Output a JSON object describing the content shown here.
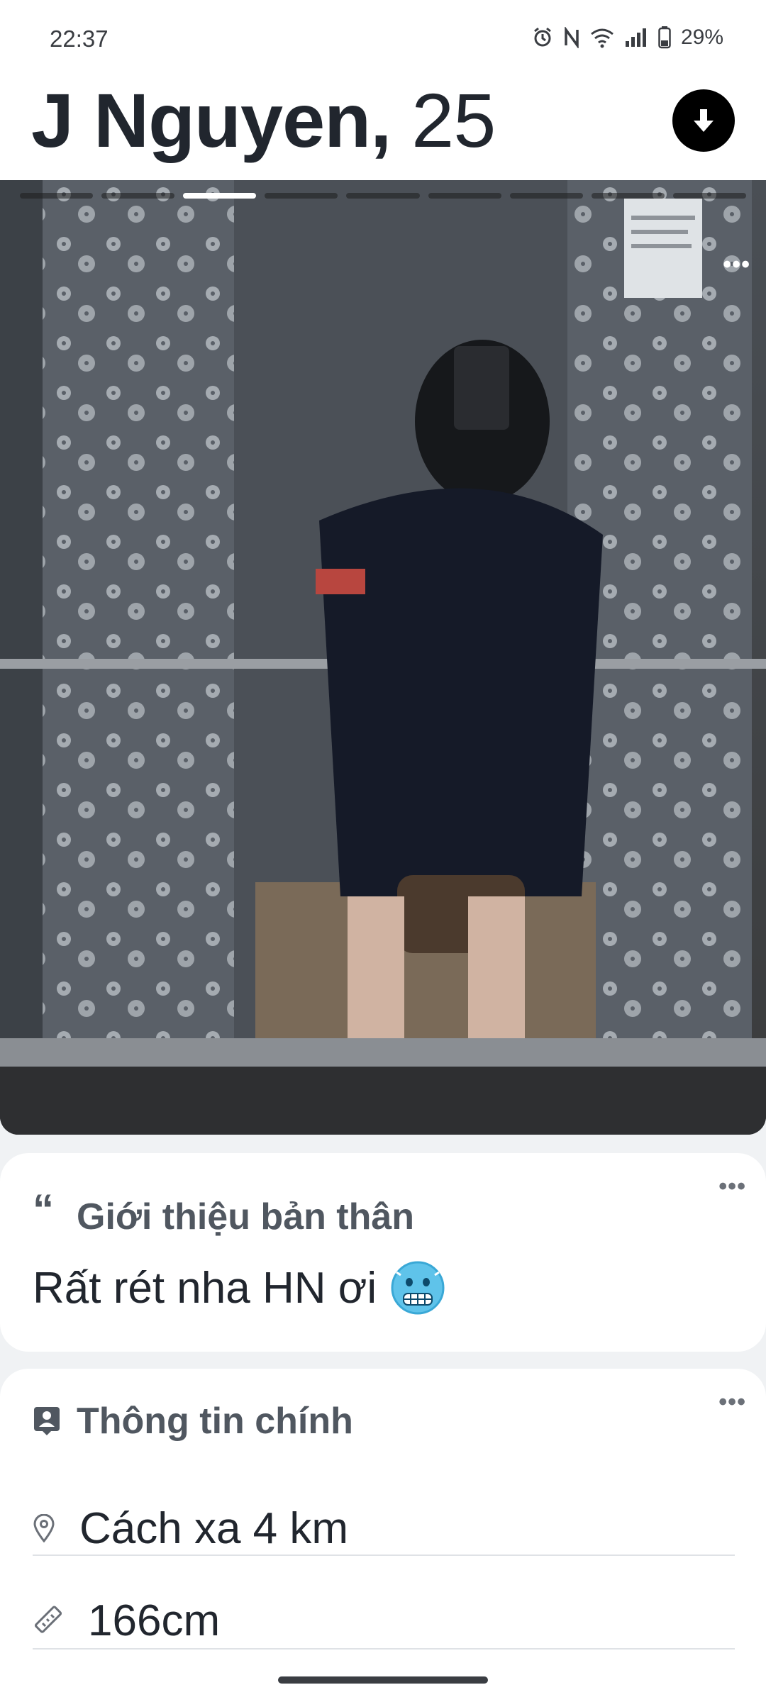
{
  "status_bar": {
    "time": "22:37",
    "battery": "29%"
  },
  "profile": {
    "name": "J Nguyen,",
    "age": "25"
  },
  "photo": {
    "segments": 9,
    "active_index": 2
  },
  "about": {
    "title": "Giới thiệu bản thân",
    "text": "Rất rét nha HN ơi",
    "emoji": "cold-face-emoji"
  },
  "main_info": {
    "title": "Thông tin chính",
    "rows": [
      {
        "icon": "location-pin-icon",
        "label": "Cách xa 4 km"
      },
      {
        "icon": "ruler-icon",
        "label": "166cm"
      }
    ]
  }
}
